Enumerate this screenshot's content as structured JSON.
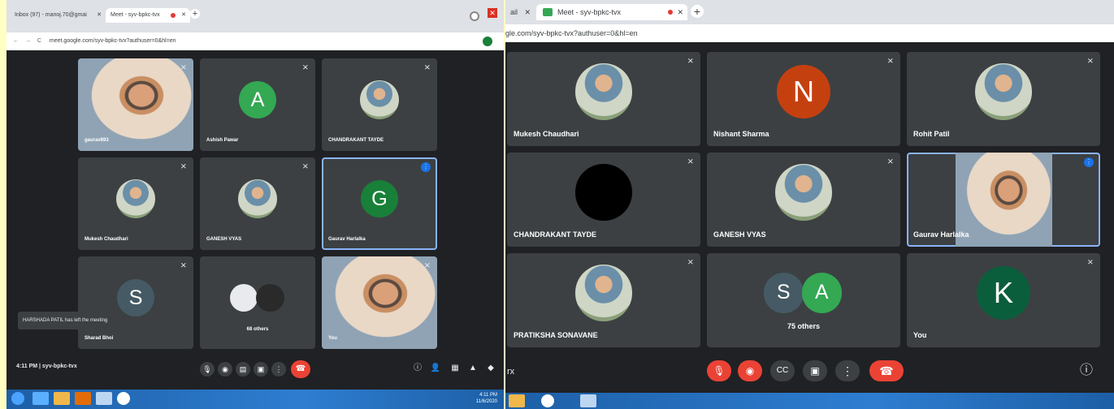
{
  "left": {
    "tabs": [
      {
        "label": "Inbox (97) - manoj.70@gmai"
      },
      {
        "label": "Meet - syv-bpkc-tvx"
      }
    ],
    "url": "meet.google.com/syv-bpkc-tvx?authuser=0&hl=en",
    "tiles": [
      {
        "name": "gaurav893",
        "kind": "video"
      },
      {
        "name": "Ashish Pawar",
        "kind": "avatar",
        "letter": "A",
        "color": "#34a853"
      },
      {
        "name": "CHANDRAKANT TAYDE",
        "kind": "photo"
      },
      {
        "name": "Mukesh Chaudhari",
        "kind": "photo"
      },
      {
        "name": "GANESH VYAS",
        "kind": "photo"
      },
      {
        "name": "Gaurav Harlalka",
        "kind": "avatar",
        "letter": "G",
        "color": "#188038",
        "speaking": true
      },
      {
        "name": "Sharad Bhoi",
        "kind": "avatar",
        "letter": "S",
        "color": "#455a64"
      },
      {
        "name": "68 others",
        "kind": "others"
      },
      {
        "name": "You",
        "kind": "video"
      }
    ],
    "toast": "HARSHADA PATIL has left the meeting",
    "meeting_info": "4:11 PM  |  syv-bpkc-tvx",
    "clock": {
      "time": "4:11 PM",
      "date": "11/6/2020"
    }
  },
  "right": {
    "tabs": [
      {
        "label": "ail"
      },
      {
        "label": "Meet - syv-bpkc-tvx"
      }
    ],
    "url": "gle.com/syv-bpkc-tvx?authuser=0&hl=en",
    "tiles": [
      {
        "name": "Mukesh Chaudhari",
        "kind": "photo"
      },
      {
        "name": "Nishant Sharma",
        "kind": "avatar",
        "letter": "N",
        "color": "#c5400f"
      },
      {
        "name": "Rohit Patil",
        "kind": "photo"
      },
      {
        "name": "CHANDRAKANT TAYDE",
        "kind": "black"
      },
      {
        "name": "GANESH VYAS",
        "kind": "photo"
      },
      {
        "name": "Gaurav Harlalka",
        "kind": "video",
        "speaking": true
      },
      {
        "name": "PRATIKSHA SONAVANE",
        "kind": "photo"
      },
      {
        "name": "75 others",
        "kind": "others",
        "letters": [
          "S",
          "A"
        ]
      },
      {
        "name": "You",
        "kind": "avatar",
        "letter": "K",
        "color": "#0b5e3c"
      }
    ],
    "meeting_code": "rx"
  },
  "icons": {
    "mic_off": "mic-off-icon",
    "cam_off": "camera-off-icon",
    "captions": "captions-icon",
    "present": "present-screen-icon",
    "more": "more-options-icon",
    "hangup": "hang-up-icon",
    "info": "info-icon"
  },
  "colors": {
    "meet_bg": "#202124",
    "tile_bg": "#3c4043",
    "hangup": "#ea4335",
    "speaking_border": "#8ab4f8"
  }
}
